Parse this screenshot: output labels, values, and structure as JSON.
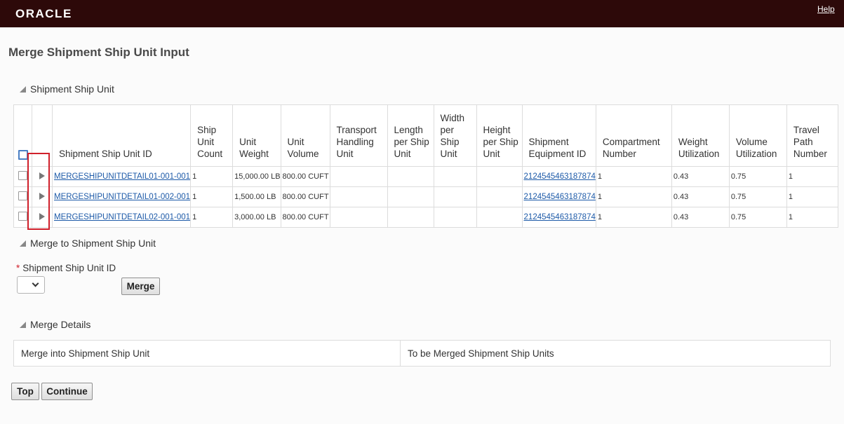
{
  "header": {
    "logo": "ORACLE",
    "help": "Help"
  },
  "page": {
    "title": "Merge Shipment Ship Unit Input"
  },
  "sections": {
    "ship_unit": "Shipment Ship Unit",
    "merge_to": "Merge to Shipment Ship Unit",
    "merge_details": "Merge Details"
  },
  "table": {
    "columns": [
      "Shipment Ship Unit ID",
      "Ship Unit Count",
      "Unit Weight",
      "Unit Volume",
      "Transport Handling Unit",
      "Length per Ship Unit",
      "Width per Ship Unit",
      "Height per Ship Unit",
      "Shipment Equipment ID",
      "Compartment Number",
      "Weight Utilization",
      "Volume Utilization",
      "Travel Path Number"
    ],
    "rows": [
      {
        "id": "MERGESHIPUNITDETAIL01-001-001",
        "count": "1",
        "weight": "15,000.00 LB",
        "volume": "800.00 CUFT",
        "thu": "",
        "length": "",
        "width": "",
        "height": "",
        "equip": "2124545463187874",
        "compartment": "1",
        "weight_util": "0.43",
        "volume_util": "0.75",
        "travel": "1"
      },
      {
        "id": "MERGESHIPUNITDETAIL01-002-001",
        "count": "1",
        "weight": "1,500.00 LB",
        "volume": "800.00 CUFT",
        "thu": "",
        "length": "",
        "width": "",
        "height": "",
        "equip": "2124545463187874",
        "compartment": "1",
        "weight_util": "0.43",
        "volume_util": "0.75",
        "travel": "1"
      },
      {
        "id": "MERGESHIPUNITDETAIL02-001-001",
        "count": "1",
        "weight": "3,000.00 LB",
        "volume": "800.00 CUFT",
        "thu": "",
        "length": "",
        "width": "",
        "height": "",
        "equip": "2124545463187874",
        "compartment": "1",
        "weight_util": "0.43",
        "volume_util": "0.75",
        "travel": "1"
      }
    ]
  },
  "merge_form": {
    "label": "Shipment Ship Unit ID",
    "required_mark": "*",
    "selected": "",
    "merge_button": "Merge"
  },
  "details": {
    "col1": "Merge into Shipment Ship Unit",
    "col2": "To be Merged Shipment Ship Units"
  },
  "footer": {
    "top_button": "Top",
    "continue_button": "Continue"
  },
  "colors": {
    "brand_bar": "#2d0909",
    "link": "#1d5aa8",
    "highlight": "#d0202b"
  }
}
